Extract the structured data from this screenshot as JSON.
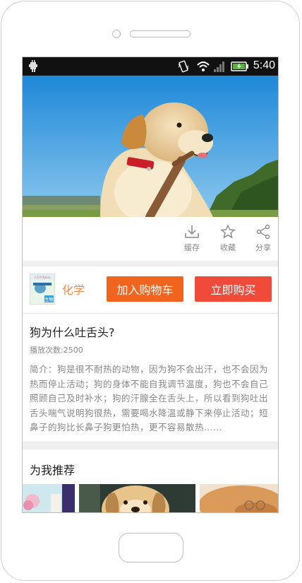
{
  "status_bar": {
    "time": "5:40"
  },
  "actions": [
    {
      "label": "缓存",
      "icon": "download-icon"
    },
    {
      "label": "收藏",
      "icon": "star-icon"
    },
    {
      "label": "分享",
      "icon": "share-icon"
    }
  ],
  "course": {
    "cover_lines": [
      "十万个为什么",
      "生物"
    ],
    "category": "化学",
    "add_to_cart_label": "加入购物车",
    "buy_now_label": "立即购买"
  },
  "video": {
    "title": "狗为什么吐舌头?",
    "play_count": "播放次数:2500",
    "intro": "简介：狗是很不耐热的动物，因为狗不会出汗，也不会因为热而停止活动；狗的身体不能自我调节温度，狗也不会自己照顾自己及时补水；狗的汗腺全在舌头上，所以看到狗吐出舌头喘气说明狗很热，需要喝水降温或静下来停止活动；短鼻子的狗比长鼻子狗更怕热，更不容易散热……"
  },
  "recommend": {
    "title": "为我推荐"
  },
  "colors": {
    "cart": "#f0641e",
    "buy": "#f04a3a",
    "category": "#f08a4b"
  }
}
